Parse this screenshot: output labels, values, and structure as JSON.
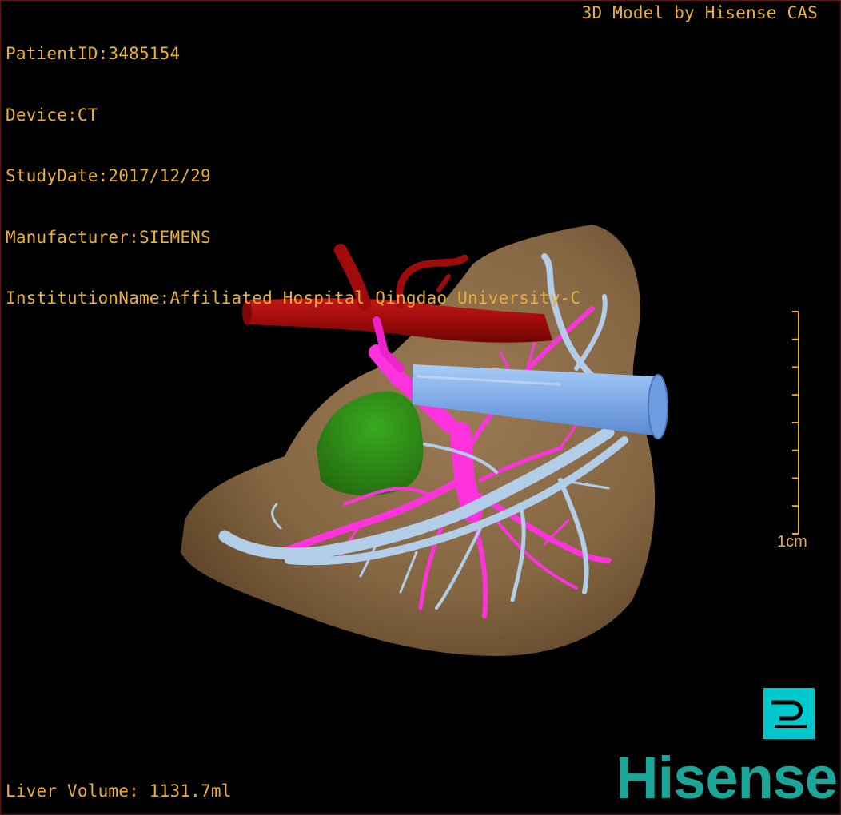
{
  "overlay": {
    "patient_id": "PatientID:3485154",
    "device": "Device:CT",
    "study_date": "StudyDate:2017/12/29",
    "manufacturer": "Manufacturer:SIEMENS",
    "institution": "InstitutionName:Affiliated Hospital Qingdao University-C",
    "credit": "3D Model by Hisense CAS",
    "liver_volume": "Liver Volume: 1131.7ml"
  },
  "scale": {
    "label": "1cm",
    "tick_count": 9
  },
  "controls": {
    "pin_icon": "pin-p-icon"
  },
  "brand": {
    "name": "Hisense",
    "color": "#1aa79a"
  },
  "colors": {
    "text": "#e8b03a",
    "liver": "#8a6a45",
    "artery": "#a80c0c",
    "hepatic_vein": "#8ebcf0",
    "portal_vein": "#ff33dd",
    "lesion": "#2a9a14",
    "pin_button_bg": "#00c8cc"
  }
}
